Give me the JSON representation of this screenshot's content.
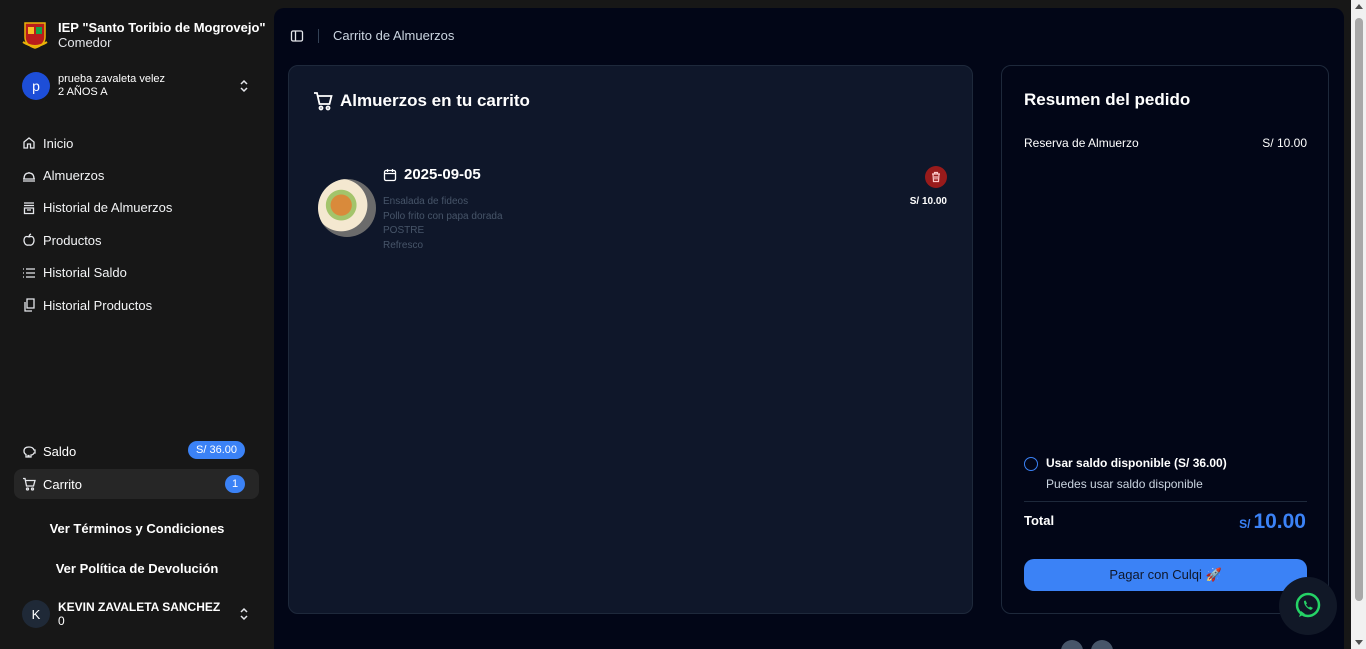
{
  "school": {
    "name": "IEP \"Santo Toribio de Mogrovejo\"",
    "subtitle": "Comedor"
  },
  "student": {
    "initial": "p",
    "name": "prueba zavaleta velez",
    "grade": "2 AÑOS A"
  },
  "sidebar": {
    "items": [
      {
        "label": "Inicio",
        "icon": "home-icon"
      },
      {
        "label": "Almuerzos",
        "icon": "cloche-icon"
      },
      {
        "label": "Historial de Almuerzos",
        "icon": "archive-icon"
      },
      {
        "label": "Productos",
        "icon": "apple-icon"
      },
      {
        "label": "Historial Saldo",
        "icon": "list-icon"
      },
      {
        "label": "Historial Productos",
        "icon": "copy-icon"
      }
    ],
    "saldo_label": "Saldo",
    "saldo_value": "S/ 36.00",
    "carrito_label": "Carrito",
    "carrito_count": "1",
    "terms_label": "Ver Términos y Condiciones",
    "policy_label": "Ver Política de Devolución"
  },
  "user": {
    "initial": "K",
    "name": "KEVIN ZAVALETA SANCHEZ",
    "sub": "0"
  },
  "breadcrumb": "Carrito de Almuerzos",
  "cart": {
    "title": "Almuerzos en tu carrito",
    "item": {
      "date": "2025-09-05",
      "lines": [
        "Ensalada de fideos",
        "Pollo frito con papa dorada",
        "POSTRE",
        "Refresco"
      ],
      "price": "S/ 10.00"
    }
  },
  "summary": {
    "title": "Resumen del pedido",
    "row_label": "Reserva de Almuerzo",
    "row_value": "S/ 10.00",
    "use_saldo_label": "Usar saldo disponible (S/ 36.00)",
    "use_saldo_sub": "Puedes usar saldo disponible",
    "total_label": "Total",
    "total_currency": "S/",
    "total_value": "10.00",
    "pay_button": "Pagar con Culqi 🚀"
  },
  "colors": {
    "accent": "#3b82f6",
    "danger": "#991b1b",
    "main_bg": "#020617",
    "card_bg": "#0f172a",
    "whatsapp": "#25d366"
  }
}
